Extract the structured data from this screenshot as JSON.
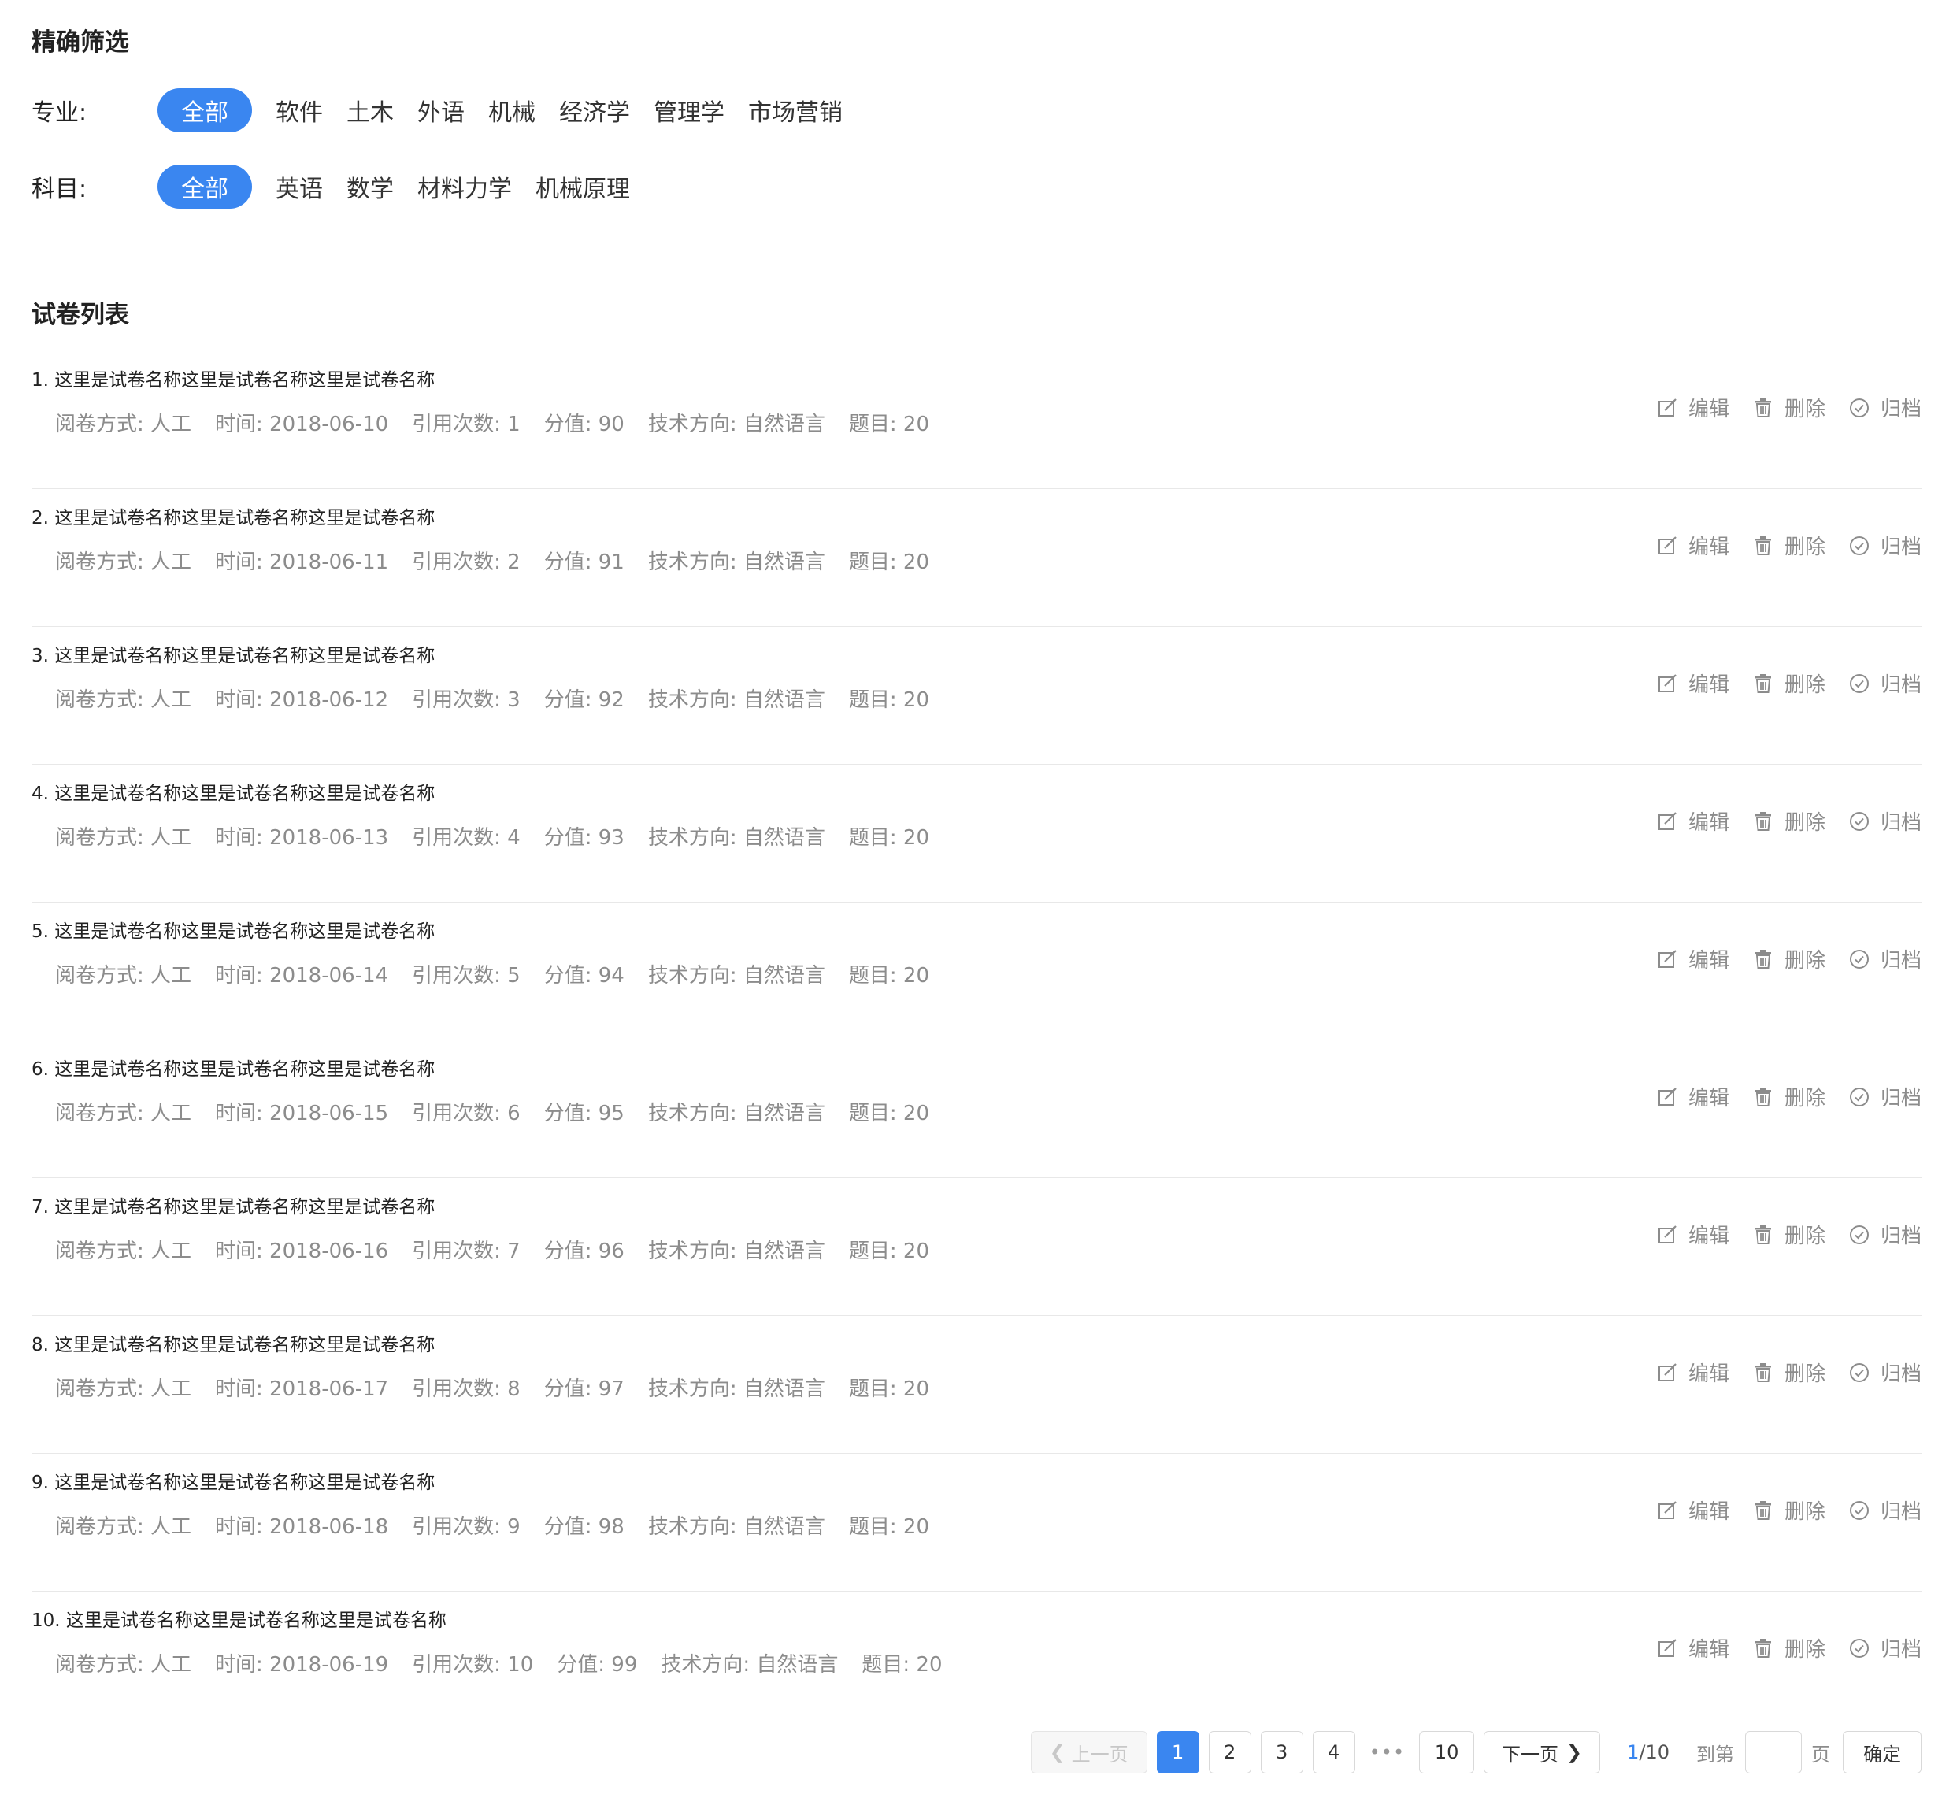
{
  "filter": {
    "title": "精确筛选",
    "major": {
      "label": "专业:",
      "options": [
        "全部",
        "软件",
        "土木",
        "外语",
        "机械",
        "经济学",
        "管理学",
        "市场营销"
      ]
    },
    "subject": {
      "label": "科目:",
      "options": [
        "全部",
        "英语",
        "数学",
        "材料力学",
        "机械原理"
      ]
    }
  },
  "list": {
    "title": "试卷列表",
    "actions": {
      "edit": "编辑",
      "delete": "删除",
      "archive": "归档"
    },
    "items": [
      {
        "title": "1. 这里是试卷名称这里是试卷名称这里是试卷名称",
        "grading": "阅卷方式: 人工",
        "time": "时间: 2018-06-10",
        "refs": "引用次数: 1",
        "score": "分值: 90",
        "tech": "技术方向: 自然语言",
        "questions": "题目: 20"
      },
      {
        "title": "2. 这里是试卷名称这里是试卷名称这里是试卷名称",
        "grading": "阅卷方式: 人工",
        "time": "时间: 2018-06-11",
        "refs": "引用次数: 2",
        "score": "分值: 91",
        "tech": "技术方向: 自然语言",
        "questions": "题目: 20"
      },
      {
        "title": "3. 这里是试卷名称这里是试卷名称这里是试卷名称",
        "grading": "阅卷方式: 人工",
        "time": "时间: 2018-06-12",
        "refs": "引用次数: 3",
        "score": "分值: 92",
        "tech": "技术方向: 自然语言",
        "questions": "题目: 20"
      },
      {
        "title": "4. 这里是试卷名称这里是试卷名称这里是试卷名称",
        "grading": "阅卷方式: 人工",
        "time": "时间: 2018-06-13",
        "refs": "引用次数: 4",
        "score": "分值: 93",
        "tech": "技术方向: 自然语言",
        "questions": "题目: 20"
      },
      {
        "title": "5. 这里是试卷名称这里是试卷名称这里是试卷名称",
        "grading": "阅卷方式: 人工",
        "time": "时间: 2018-06-14",
        "refs": "引用次数: 5",
        "score": "分值: 94",
        "tech": "技术方向: 自然语言",
        "questions": "题目: 20"
      },
      {
        "title": "6. 这里是试卷名称这里是试卷名称这里是试卷名称",
        "grading": "阅卷方式: 人工",
        "time": "时间: 2018-06-15",
        "refs": "引用次数: 6",
        "score": "分值: 95",
        "tech": "技术方向: 自然语言",
        "questions": "题目: 20"
      },
      {
        "title": "7. 这里是试卷名称这里是试卷名称这里是试卷名称",
        "grading": "阅卷方式: 人工",
        "time": "时间: 2018-06-16",
        "refs": "引用次数: 7",
        "score": "分值: 96",
        "tech": "技术方向: 自然语言",
        "questions": "题目: 20"
      },
      {
        "title": "8. 这里是试卷名称这里是试卷名称这里是试卷名称",
        "grading": "阅卷方式: 人工",
        "time": "时间: 2018-06-17",
        "refs": "引用次数: 8",
        "score": "分值: 97",
        "tech": "技术方向: 自然语言",
        "questions": "题目: 20"
      },
      {
        "title": "9. 这里是试卷名称这里是试卷名称这里是试卷名称",
        "grading": "阅卷方式: 人工",
        "time": "时间: 2018-06-18",
        "refs": "引用次数: 9",
        "score": "分值: 98",
        "tech": "技术方向: 自然语言",
        "questions": "题目: 20"
      },
      {
        "title": "10. 这里是试卷名称这里是试卷名称这里是试卷名称",
        "grading": "阅卷方式: 人工",
        "time": "时间: 2018-06-19",
        "refs": "引用次数: 10",
        "score": "分值: 99",
        "tech": "技术方向: 自然语言",
        "questions": "题目: 20"
      }
    ]
  },
  "pagination": {
    "prev": "上一页",
    "next": "下一页",
    "pages": [
      "1",
      "2",
      "3",
      "4"
    ],
    "ellipsis": "•••",
    "last": "10",
    "current": "1",
    "total": "/10",
    "goto_label": "到第",
    "page_word": "页",
    "confirm": "确定"
  },
  "colors": {
    "accent": "#3a86f0",
    "muted_text": "#8c8c8c",
    "divider": "#e8e8e8"
  }
}
